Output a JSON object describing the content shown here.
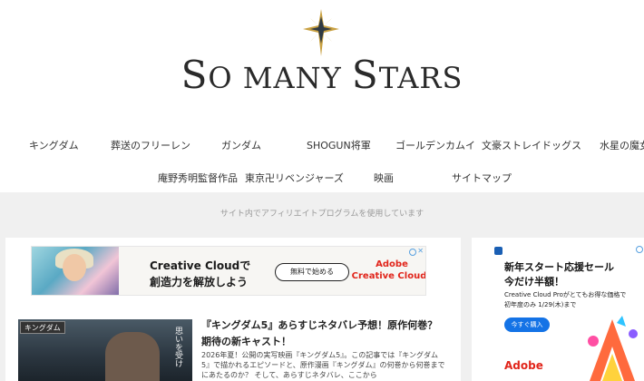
{
  "site": {
    "title_first": "S",
    "title_rest_1": "O ",
    "title_second": "MANY ",
    "title_third": "S",
    "title_rest_2": "TARS"
  },
  "nav": {
    "row1": [
      "キングダム",
      "葬送のフリーレン",
      "ガンダム",
      "SHOGUN将軍",
      "ゴールデンカムイ",
      "文豪ストレイドッグス",
      "水星の魔女"
    ],
    "row2": [
      "庵野秀明監督作品",
      "東京卍リベンジャーズ",
      "映画",
      "サイトマップ"
    ]
  },
  "disclosure": "サイト内でアフィリエイトプログラムを使用しています",
  "ad_main": {
    "line1": "Creative Cloudで",
    "line2": "創造力を解放しよう",
    "cta": "無料で始める",
    "brand1": "Adobe",
    "brand2": "Creative Cloud",
    "close": "✕"
  },
  "article": {
    "category": "キングダム",
    "thumb_text": "思いを受け",
    "title": "『キングダム5』あらすじネタバレ予想！原作何巻？期待の新キャスト！",
    "excerpt": "2026年夏！公開の実写映画『キングダム5』。この記事では『キングダム5』で描かれるエピソードと、原作漫画『キングダム』の何巻から何巻までにあたるのか？ そして、あらすじネタバレ、ここから"
  },
  "side_ad": {
    "headline1": "新年スタート応援セール",
    "headline2": "今だけ半額！",
    "para1": "Creative Cloud Proがとてもお得な価格で",
    "para2": "初年度のみ 1/29(木)まで",
    "button": "今すぐ購入",
    "brand": "Adobe"
  },
  "colors": {
    "accent": "#e1251b",
    "button_blue": "#1473e6",
    "band_gray": "#f0f0f0"
  }
}
